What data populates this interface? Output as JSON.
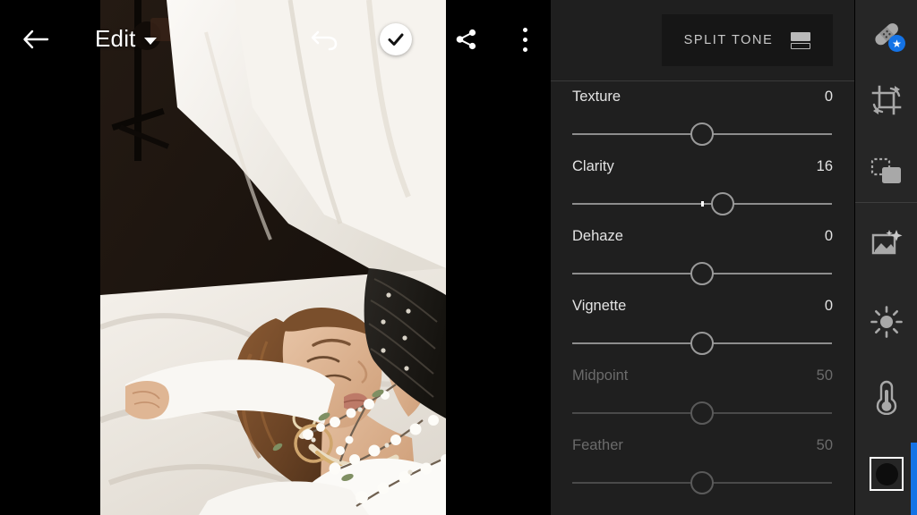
{
  "app": {
    "screen_title": "Edit",
    "active_tool": "Effects"
  },
  "topbar": {
    "back_icon": "arrow-left-icon",
    "title": "Edit",
    "title_chevron_icon": "chevron-down-icon",
    "undo_icon": "undo-icon",
    "confirm_icon": "check-icon",
    "share_icon": "share-icon",
    "more_icon": "more-vertical-icon"
  },
  "panel": {
    "header": {
      "button_label": "SPLIT TONE",
      "button_icon": "split-tone-icon"
    },
    "sliders": [
      {
        "label": "Texture",
        "value": "0",
        "fraction": 0.5,
        "disabled": false,
        "tick": false
      },
      {
        "label": "Clarity",
        "value": "16",
        "fraction": 0.58,
        "disabled": false,
        "tick": true
      },
      {
        "label": "Dehaze",
        "value": "0",
        "fraction": 0.5,
        "disabled": false,
        "tick": false
      },
      {
        "label": "Vignette",
        "value": "0",
        "fraction": 0.5,
        "disabled": false,
        "tick": false
      },
      {
        "label": "Midpoint",
        "value": "50",
        "fraction": 0.5,
        "disabled": true,
        "tick": false
      },
      {
        "label": "Feather",
        "value": "50",
        "fraction": 0.5,
        "disabled": true,
        "tick": false
      }
    ]
  },
  "rail": {
    "items": [
      {
        "icon": "healing-brush-icon",
        "badge": "★"
      },
      {
        "icon": "crop-rotate-icon",
        "badge": ""
      },
      {
        "icon": "presets-layers-icon",
        "badge": ""
      },
      {
        "icon": "auto-enhance-icon",
        "badge": ""
      },
      {
        "icon": "light-sun-icon",
        "badge": ""
      },
      {
        "icon": "color-thermometer-icon",
        "badge": ""
      },
      {
        "icon": "effects-vignette-icon",
        "badge": ""
      }
    ],
    "scrollbar": "vertical-scroll-indicator"
  },
  "colors": {
    "accent": "#1473e6",
    "panel_bg": "#1f1f1f",
    "rail_bg": "#262626",
    "canvas_bg": "#000000",
    "track": "#8d8d8d",
    "text": "#e3e3e3",
    "text_disabled": "#6b6b6b"
  }
}
